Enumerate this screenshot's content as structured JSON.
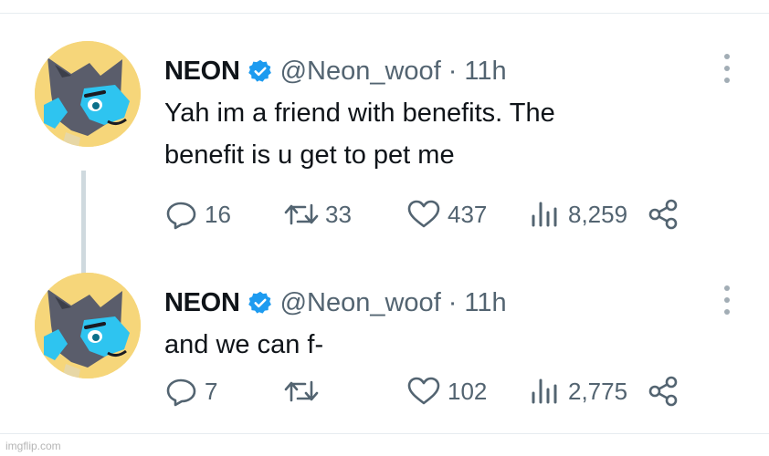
{
  "tweets": [
    {
      "name": "NEON",
      "handle": "@Neon_woof",
      "separator": "·",
      "time": "11h",
      "text": "Yah im a friend with benefits. The\nbenefit is u get to pet me",
      "replies": "16",
      "retweets": "33",
      "likes": "437",
      "views": "8,259"
    },
    {
      "name": "NEON",
      "handle": "@Neon_woof",
      "separator": "·",
      "time": "11h",
      "text": "and we can f-",
      "replies": "7",
      "retweets": "",
      "likes": "102",
      "views": "2,775"
    }
  ],
  "watermark": "imgflip.com",
  "colors": {
    "verified": "#1d9bf0",
    "muted": "#536471",
    "avatar_bg": "#f6d67a",
    "fur_blue": "#2ec4f0",
    "fur_gray": "#5a5d6b"
  },
  "icons": [
    "verified-badge-icon",
    "more-icon",
    "reply-icon",
    "retweet-icon",
    "like-icon",
    "views-icon",
    "share-icon"
  ]
}
